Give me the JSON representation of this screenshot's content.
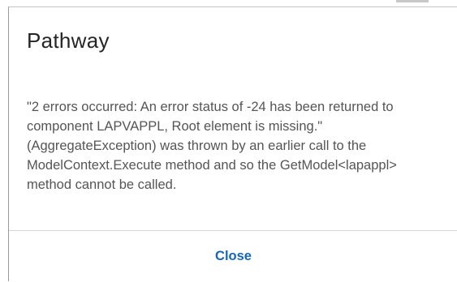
{
  "dialog": {
    "title": "Pathway",
    "message": "\"2 errors occurred: An error status of -24 has been returned to component LAPVAPPL, Root element is missing.\" (AggregateException) was thrown by an earlier call to the ModelContext.Execute method and so the GetModel<lapappl> method cannot be called.",
    "close_label": "Close"
  },
  "colors": {
    "accent": "#1565c0",
    "title_text": "#262626",
    "body_text": "#555555",
    "divider": "#d6d6d6"
  }
}
